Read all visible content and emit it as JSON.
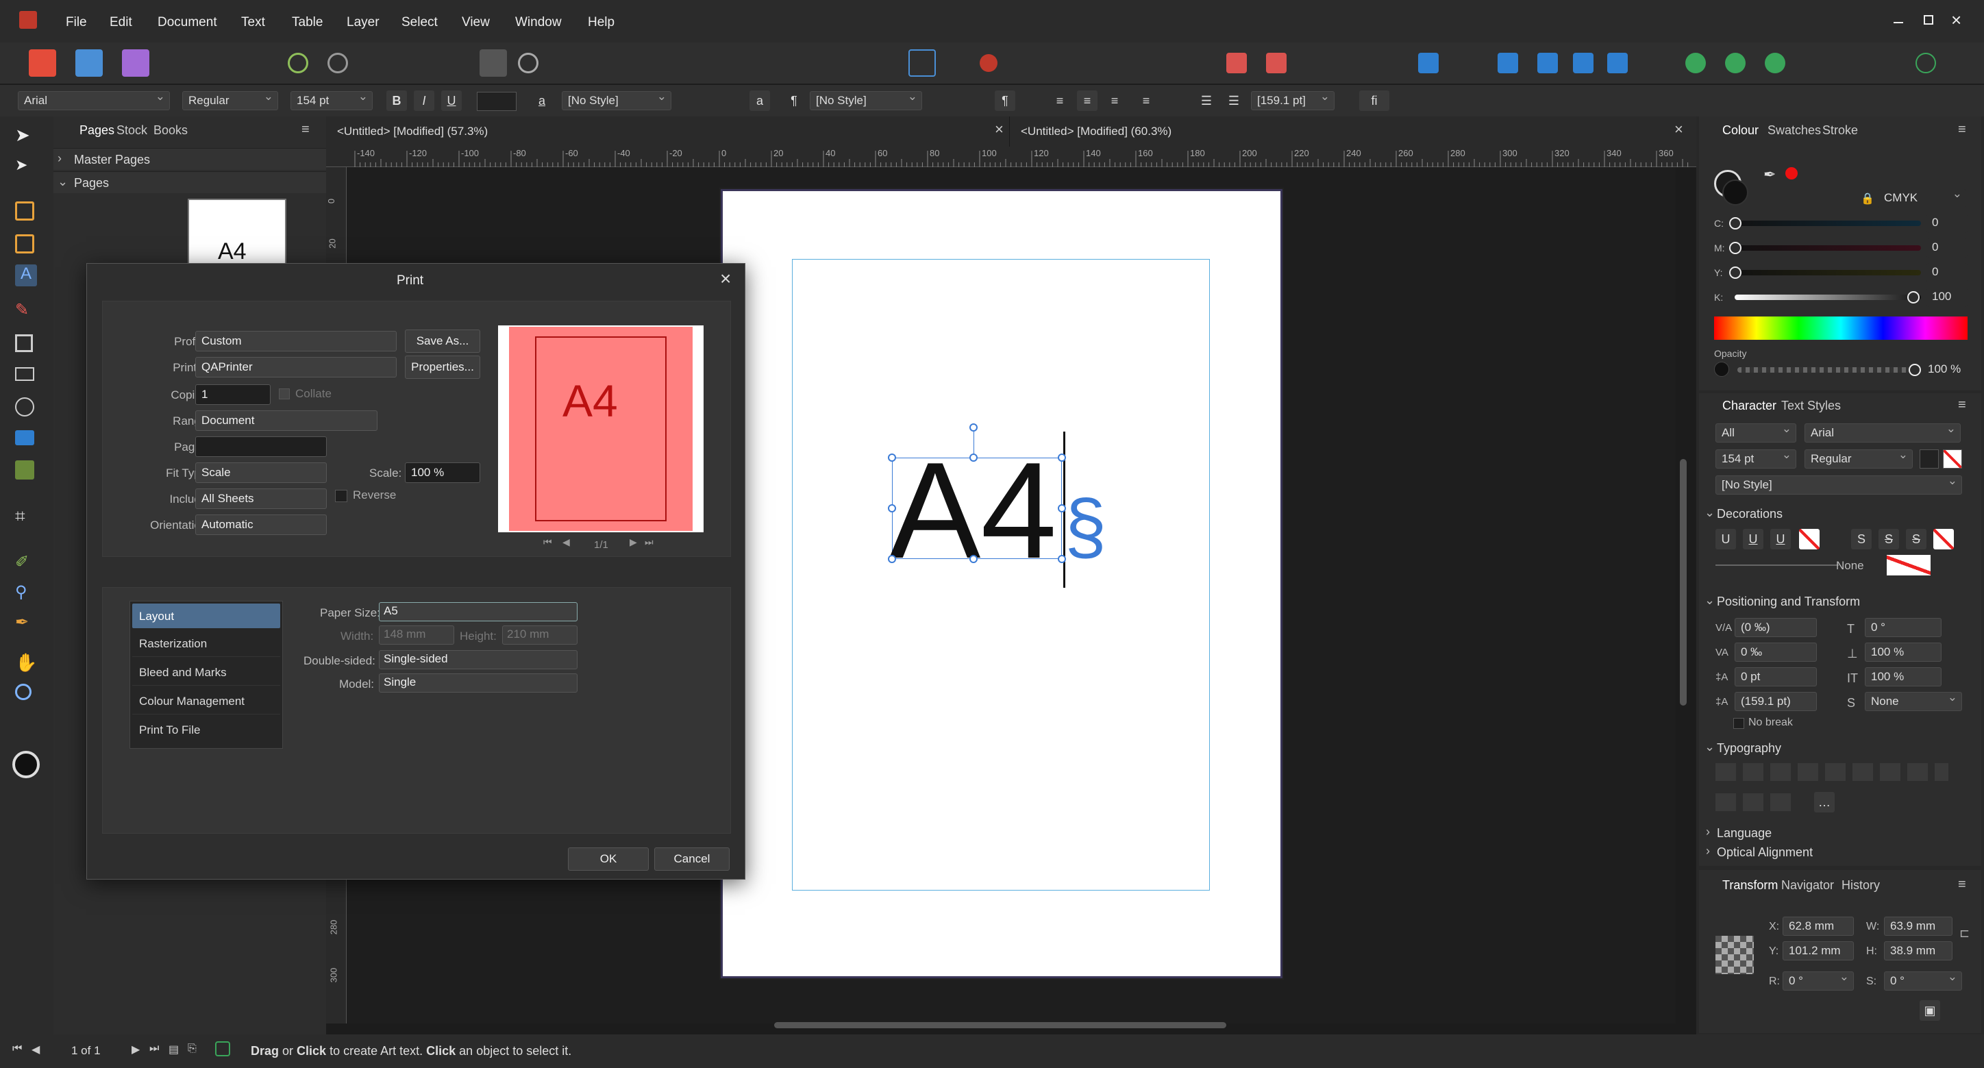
{
  "menu": [
    "File",
    "Edit",
    "Document",
    "Text",
    "Table",
    "Layer",
    "Select",
    "View",
    "Window",
    "Help"
  ],
  "context": {
    "font": "Arial",
    "style": "Regular",
    "size": "154 pt",
    "para_style": "[No Style]",
    "char_style": "[No Style]",
    "leading": "[159.1 pt]",
    "ligature_label": "fi"
  },
  "left_panel": {
    "tabs": [
      "Pages",
      "Stock",
      "Books"
    ],
    "master_pages": "Master Pages",
    "pages": "Pages",
    "thumb_text": "A4"
  },
  "doc_tabs": [
    "<Untitled> [Modified] (57.3%)",
    "<Untitled> [Modified] (60.3%)"
  ],
  "ruler_ticks": [
    "-140",
    "-120",
    "-100",
    "-80",
    "-60",
    "-40",
    "-20",
    "0",
    "20",
    "40",
    "60",
    "80",
    "100",
    "120",
    "140",
    "160",
    "180",
    "200",
    "220",
    "240",
    "260",
    "280",
    "300",
    "320",
    "340",
    "360"
  ],
  "vruler_ticks": [
    "0",
    "20",
    "280",
    "300"
  ],
  "canvas": {
    "text": "A4",
    "glyph": "§"
  },
  "print": {
    "title": "Print",
    "labels": {
      "profile": "Profile:",
      "printer": "Printer:",
      "copies": "Copies:",
      "collate": "Collate",
      "range": "Range:",
      "pages": "Pages:",
      "fit_type": "Fit Type:",
      "scale": "Scale:",
      "include": "Include:",
      "reverse": "Reverse",
      "orientation": "Orientation:"
    },
    "values": {
      "profile": "Custom",
      "printer": "QAPrinter",
      "copies": "1",
      "range": "Document",
      "fit_type": "Scale",
      "scale": "100 %",
      "include": "All Sheets",
      "orientation": "Automatic"
    },
    "buttons": {
      "save_as": "Save As...",
      "properties": "Properties...",
      "ok": "OK",
      "cancel": "Cancel"
    },
    "preview": {
      "text": "A4",
      "page": "1/1"
    },
    "sections": [
      "Layout",
      "Rasterization",
      "Bleed and Marks",
      "Colour Management",
      "Print To File"
    ],
    "layout": {
      "paper_size_label": "Paper Size:",
      "paper_size": "A5",
      "width_label": "Width:",
      "width": "148 mm",
      "height_label": "Height:",
      "height": "210 mm",
      "double_sided_label": "Double-sided:",
      "double_sided": "Single-sided",
      "model_label": "Model:",
      "model": "Single"
    }
  },
  "colour": {
    "tabs": [
      "Colour",
      "Swatches",
      "Stroke"
    ],
    "mode": "CMYK",
    "channels": [
      {
        "label": "C:",
        "value": "0"
      },
      {
        "label": "M:",
        "value": "0"
      },
      {
        "label": "Y:",
        "value": "0"
      },
      {
        "label": "K:",
        "value": "100"
      }
    ],
    "opacity_label": "Opacity",
    "opacity": "100 %"
  },
  "character": {
    "tabs": [
      "Character",
      "Text Styles"
    ],
    "scope": "All",
    "font": "Arial",
    "size": "154 pt",
    "style": "Regular",
    "char_style": "[No Style]",
    "decorations": "Decorations",
    "none": "None",
    "pos_transform": "Positioning and Transform",
    "fields": {
      "kern": "(0 ‰)",
      "track": "0 ‰",
      "baseline": "0 pt",
      "leading": "(159.1 pt)",
      "shear": "0 °",
      "hscale": "100 %",
      "vscale": "100 %",
      "none": "None"
    },
    "no_break": "No break",
    "typography": "Typography",
    "language": "Language",
    "optical": "Optical Alignment"
  },
  "transform": {
    "tabs": [
      "Transform",
      "Navigator",
      "History"
    ],
    "x_label": "X:",
    "x": "62.8 mm",
    "y_label": "Y:",
    "y": "101.2 mm",
    "w_label": "W:",
    "w": "63.9 mm",
    "h_label": "H:",
    "h": "38.9 mm",
    "r_label": "R:",
    "r": "0 °",
    "s_label": "S:",
    "s": "0 °"
  },
  "status": {
    "page": "1 of 1",
    "hint_a": "Drag",
    "hint_b": " or ",
    "hint_c": "Click",
    "hint_d": " to create Art text. ",
    "hint_e": "Click",
    "hint_f": " an object to select it."
  }
}
